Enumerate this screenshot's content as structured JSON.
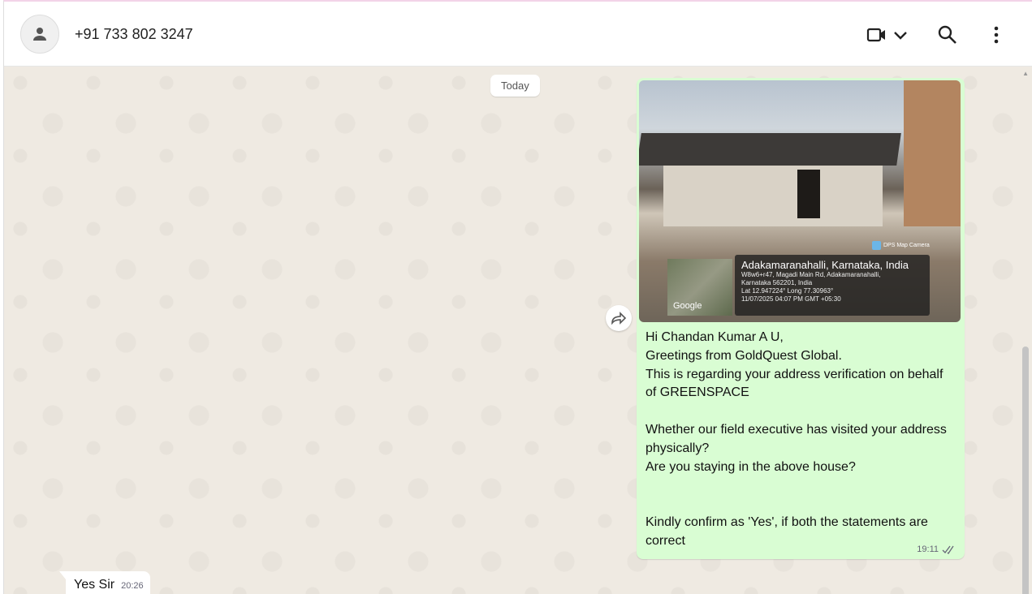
{
  "header": {
    "contact": "+91 733 802 3247",
    "icons": [
      "avatar-person-icon",
      "video-call-icon",
      "chevron-down-icon",
      "search-icon",
      "more-vertical-icon"
    ]
  },
  "chat": {
    "date_chip": "Today",
    "outgoing": {
      "photo": {
        "place": "Adakamaranahalli, Karnataka, India",
        "address1": "W8w6+r47, Magadi Main Rd, Adakamaranahalli,",
        "address2": "Karnataka 562201, India",
        "coords": "Lat 12.947224° Long 77.30963°",
        "datetime": "11/07/2025 04:07 PM GMT +05:30",
        "app": "DPS Map Camera",
        "map_logo": "Google"
      },
      "text": "Hi Chandan Kumar A U,\nGreetings from GoldQuest Global.\nThis is regarding your address verification on behalf of GREENSPACE\n\nWhether our field executive has visited your address physically?\nAre you staying in the above house?\n\n\nKindly confirm as 'Yes', if both the statements are correct",
      "time": "19:11",
      "status": "read"
    },
    "incoming": {
      "text": "Yes Sir",
      "time": "20:26"
    }
  }
}
